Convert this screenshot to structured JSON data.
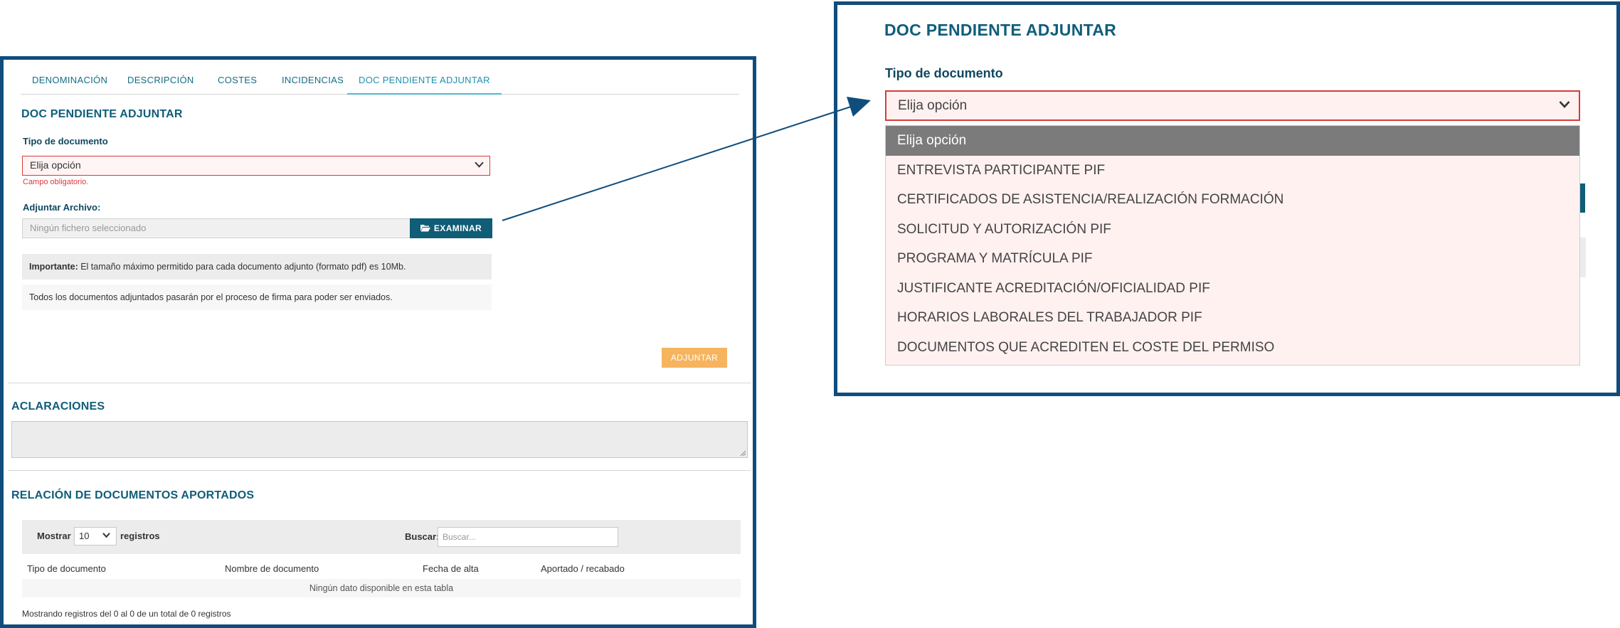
{
  "tabs": [
    {
      "label": "DENOMINACIÓN"
    },
    {
      "label": "DESCRIPCIÓN"
    },
    {
      "label": "COSTES"
    },
    {
      "label": "INCIDENCIAS"
    },
    {
      "label": "DOC PENDIENTE ADJUNTAR",
      "active": true
    }
  ],
  "doc_section": {
    "title": "DOC PENDIENTE ADJUNTAR",
    "tipo_label": "Tipo de documento",
    "tipo_value": "Elija opción",
    "required_msg": "Campo obligatorio.",
    "adjuntar_label": "Adjuntar Archivo:",
    "file_placeholder": "Ningún fichero seleccionado",
    "examinar_label": "EXAMINAR",
    "important_bold": "Importante:",
    "important_text": " El tamaño máximo permitido para cada documento adjunto (formato pdf) es 10Mb.",
    "firma_text": "Todos los documentos adjuntados pasarán por el proceso de firma para poder ser enviados.",
    "adjuntar_button": "ADJUNTAR"
  },
  "aclaraciones": {
    "title": "ACLARACIONES"
  },
  "relacion": {
    "title": "RELACIÓN DE DOCUMENTOS APORTADOS",
    "mostrar_label": "Mostrar",
    "page_size": "10",
    "registros_label": "registros",
    "buscar_label": "Buscar:",
    "buscar_placeholder": "Buscar...",
    "columns": [
      "Tipo de documento",
      "Nombre de documento",
      "Fecha de alta",
      "Aportado / recabado"
    ],
    "empty_text": "Ningún dato disponible en esta tabla",
    "footer_text": "Mostrando registros del 0 al 0 de un total de 0 registros"
  },
  "zoom": {
    "title": "DOC PENDIENTE ADJUNTAR",
    "tipo_label": "Tipo de documento",
    "tipo_value": "Elija opción",
    "options": [
      "Elija opción",
      "ENTREVISTA PARTICIPANTE PIF",
      "CERTIFICADOS DE ASISTENCIA/REALIZACIÓN FORMACIÓN",
      "SOLICITUD Y AUTORIZACIÓN PIF",
      "PROGRAMA Y MATRÍCULA PIF",
      "JUSTIFICANTE ACREDITACIÓN/OFICIALIDAD PIF",
      "HORARIOS LABORALES DEL TRABAJADOR PIF",
      "DOCUMENTOS QUE ACREDITEN EL COSTE DEL PERMISO"
    ],
    "selected_index": 0
  },
  "colors": {
    "frame": "#104d7c",
    "accent": "#0f5d7a",
    "error": "#d83a3a",
    "orange_button": "#f6b45e",
    "selected_option": "#7b7b7b"
  },
  "icons": {
    "folder": "folder-open-icon",
    "chevron": "chevron-down-icon"
  }
}
